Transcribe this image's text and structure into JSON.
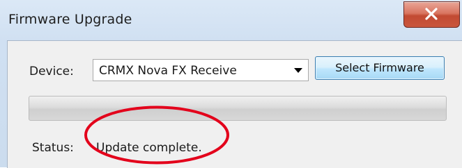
{
  "window": {
    "title": "Firmware Upgrade",
    "close_icon": "close-icon"
  },
  "device": {
    "label": "Device:",
    "selected": "CRMX Nova FX Receive",
    "dropdown_icon": "chevron-down-icon"
  },
  "select_firmware": {
    "label": "Select Firmware"
  },
  "progress": {
    "value": 0
  },
  "status": {
    "label": "Status:",
    "value": "Update complete."
  },
  "annotation": {
    "shape": "ellipse",
    "color": "#e3001b"
  },
  "colors": {
    "title_bar": "#d0e0f2",
    "close_button": "#c94c34",
    "button_border": "#3c7fb1"
  }
}
